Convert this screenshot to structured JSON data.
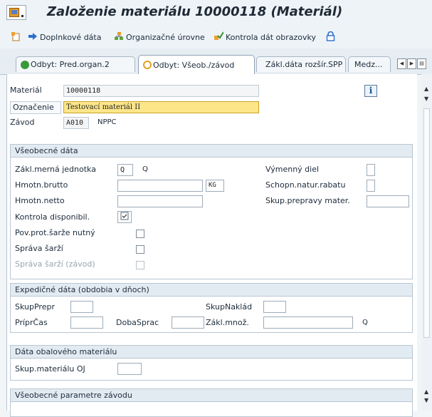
{
  "window": {
    "title": "Založenie materiálu 10000118 (Materiál)"
  },
  "toolbar": {
    "items": [
      {
        "label": "Doplnkové dáta",
        "icon": "arrow-right-icon"
      },
      {
        "label": "Organizačné úrovne",
        "icon": "org-levels-icon"
      },
      {
        "label": "Kontrola dát obrazovky",
        "icon": "check-data-icon"
      }
    ],
    "extra_icon": "lock-icon"
  },
  "tabs": [
    {
      "label": "Odbyt: Pred.organ.2",
      "icon": "check-icon",
      "active": false
    },
    {
      "label": "Odbyt: Všeob./závod",
      "icon": "circle-icon",
      "active": true
    },
    {
      "label": "Zákl.dáta rozšír.SPP",
      "icon": "",
      "active": false
    },
    {
      "label": "Medz...",
      "icon": "",
      "active": false
    }
  ],
  "header": {
    "material_label": "Materiál",
    "material_value": "10000118",
    "description_label": "Označenie",
    "description_value": "Testovací materiál II",
    "plant_label": "Závod",
    "plant_value": "A010",
    "plant_name": "NPPC"
  },
  "general_data": {
    "title": "Všeobecné dáta",
    "base_uom_label": "Zákl.merná jednotka",
    "base_uom_value": "Q",
    "base_uom_text": "Q",
    "gross_weight_label": "Hmotn.brutto",
    "gross_weight_value": "",
    "weight_unit_value": "KG",
    "net_weight_label": "Hmotn.netto",
    "net_weight_value": "",
    "availability_check_label": "Kontrola disponibil.",
    "availability_check_value": "",
    "batch_required_label": "Pov.prot.šarže nutný",
    "batch_mgmt_label": "Správa šarží",
    "batch_mgmt_plant_label": "Správa šarží (závod)",
    "replacement_part_label": "Výmenný diel",
    "replacement_part_value": "",
    "cash_discount_label": "Schopn.natur.rabatu",
    "cash_discount_value": "",
    "transport_group_label": "Skup.prepravy mater.",
    "transport_group_value": ""
  },
  "shipping_data": {
    "title": "Expedičné dáta (obdobia v dňoch)",
    "trans_grp_label": "SkupPrepr",
    "trans_grp_value": "",
    "load_grp_label": "SkupNaklád",
    "load_grp_value": "",
    "setup_time_label": "PríprČas",
    "setup_time_value": "",
    "proc_time_label": "DobaSprac",
    "proc_time_value": "",
    "base_qty_label": "Zákl.množ.",
    "base_qty_value": "",
    "base_qty_unit": "Q"
  },
  "packaging_data": {
    "title": "Dáta obalového materiálu",
    "mat_grp_label": "Skup.materiálu OJ",
    "mat_grp_value": ""
  },
  "plant_params": {
    "title": "Všeobecné parametre závodu"
  }
}
